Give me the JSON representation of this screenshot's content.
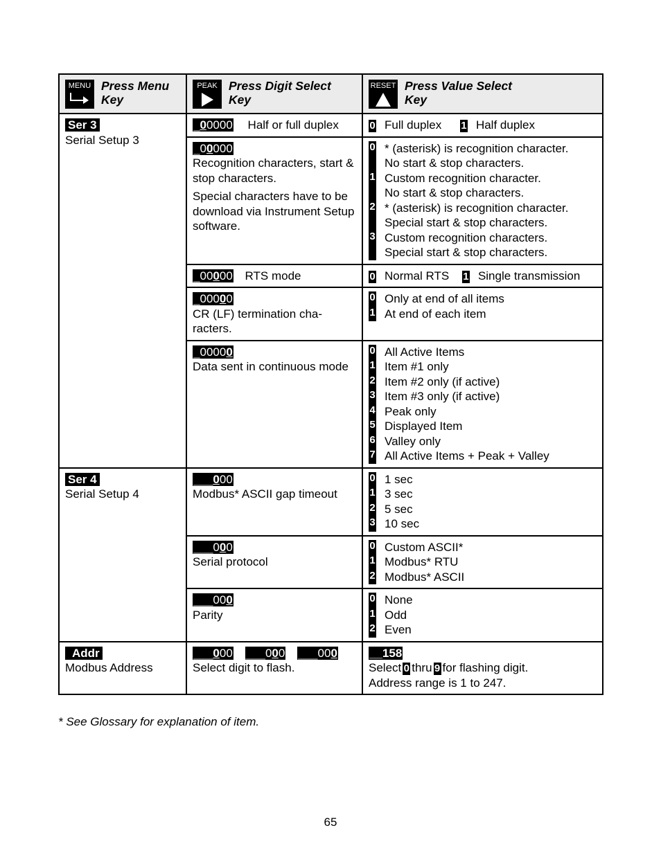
{
  "header": {
    "col1": {
      "key_label": "MENU",
      "title_line1": "Press Menu",
      "title_line2": "Key",
      "icon": "menu-arrow-icon"
    },
    "col2": {
      "key_label": "PEAK",
      "title_line1": "Press Digit Select",
      "title_line2": "Key",
      "icon": "right-triangle-icon"
    },
    "col3": {
      "key_label": "RESET",
      "title_line1": "Press Value Select",
      "title_line2": "Key",
      "icon": "up-triangle-icon"
    }
  },
  "sections": [
    {
      "label": "Ser 3",
      "name": "Serial Setup 3",
      "rows": [
        {
          "display": "_00000",
          "highlight_index": 1,
          "desc": "Half or full duplex",
          "options_inline": [
            {
              "digit": "0",
              "text": "Full duplex"
            },
            {
              "digit": "1",
              "text": "Half duplex"
            }
          ]
        },
        {
          "display": "_00000",
          "highlight_index": 2,
          "desc": "Recognition characters, start & stop characters.",
          "note": "Special characters have to be download via Instrument Setup software.",
          "options": [
            {
              "digit": "0",
              "line1": "* (asterisk) is recognition character.",
              "line2": "No start & stop characters."
            },
            {
              "digit": "1",
              "line1": "Custom recognition character.",
              "line2": "No start & stop characters."
            },
            {
              "digit": "2",
              "line1": "* (asterisk) is recognition character.",
              "line2": "Special start & stop characters."
            },
            {
              "digit": "3",
              "line1": "Custom recognition characters.",
              "line2": "Special start & stop characters."
            }
          ]
        },
        {
          "display": "_00000",
          "highlight_index": 3,
          "desc": "RTS mode",
          "options_inline": [
            {
              "digit": "0",
              "text": "Normal RTS"
            },
            {
              "digit": "1",
              "text": "Single transmission"
            }
          ]
        },
        {
          "display": "_00000",
          "highlight_index": 4,
          "desc": "CR (LF) termination cha-racters.",
          "options": [
            {
              "digit": "0",
              "text": "Only at end of all items"
            },
            {
              "digit": "1",
              "text": "At end of each item"
            }
          ]
        },
        {
          "display": "_00000",
          "highlight_index": 5,
          "desc": "Data sent in continuous mode",
          "options": [
            {
              "digit": "0",
              "text": "All Active Items"
            },
            {
              "digit": "1",
              "text": "Item #1 only"
            },
            {
              "digit": "2",
              "text": "Item #2 only (if active)"
            },
            {
              "digit": "3",
              "text": "Item #3 only (if active)"
            },
            {
              "digit": "4",
              "text": "Peak only"
            },
            {
              "digit": "5",
              "text": "Displayed Item"
            },
            {
              "digit": "6",
              "text": "Valley only"
            },
            {
              "digit": "7",
              "text": "All Active Items + Peak + Valley"
            }
          ]
        }
      ]
    },
    {
      "label": "Ser 4",
      "name": "Serial Setup 4",
      "rows": [
        {
          "display": "___000",
          "highlight_index": 3,
          "desc": "Modbus* ASCII gap timeout",
          "options": [
            {
              "digit": "0",
              "text": "1 sec"
            },
            {
              "digit": "1",
              "text": "3 sec"
            },
            {
              "digit": "2",
              "text": "5 sec"
            },
            {
              "digit": "3",
              "text": "10 sec"
            }
          ]
        },
        {
          "display": "___000",
          "highlight_index": 4,
          "desc": "Serial protocol",
          "options": [
            {
              "digit": "0",
              "text": "Custom ASCII*"
            },
            {
              "digit": "1",
              "text": "Modbus* RTU"
            },
            {
              "digit": "2",
              "text": "Modbus* ASCII"
            }
          ]
        },
        {
          "display": "___000",
          "highlight_index": 5,
          "desc": "Parity",
          "options": [
            {
              "digit": "0",
              "text": "None"
            },
            {
              "digit": "1",
              "text": "Odd"
            },
            {
              "digit": "2",
              "text": "Even"
            }
          ]
        }
      ]
    },
    {
      "label": "Addr",
      "name": "Modbus Address",
      "displays": [
        {
          "display": "___000",
          "highlight_index": 3
        },
        {
          "display": "___000",
          "highlight_index": 4
        },
        {
          "display": "___000",
          "highlight_index": 5
        }
      ],
      "desc": "Select digit to flash.",
      "value_display": "__158",
      "value_text_a": "Select",
      "value_digit_a": "0",
      "value_text_b": "thru",
      "value_digit_b": "9",
      "value_text_c": "for flashing digit.",
      "range_text": "Address range is 1 to 247."
    }
  ],
  "footnote": "* See Glossary for explanation of item.",
  "page_number": "65"
}
